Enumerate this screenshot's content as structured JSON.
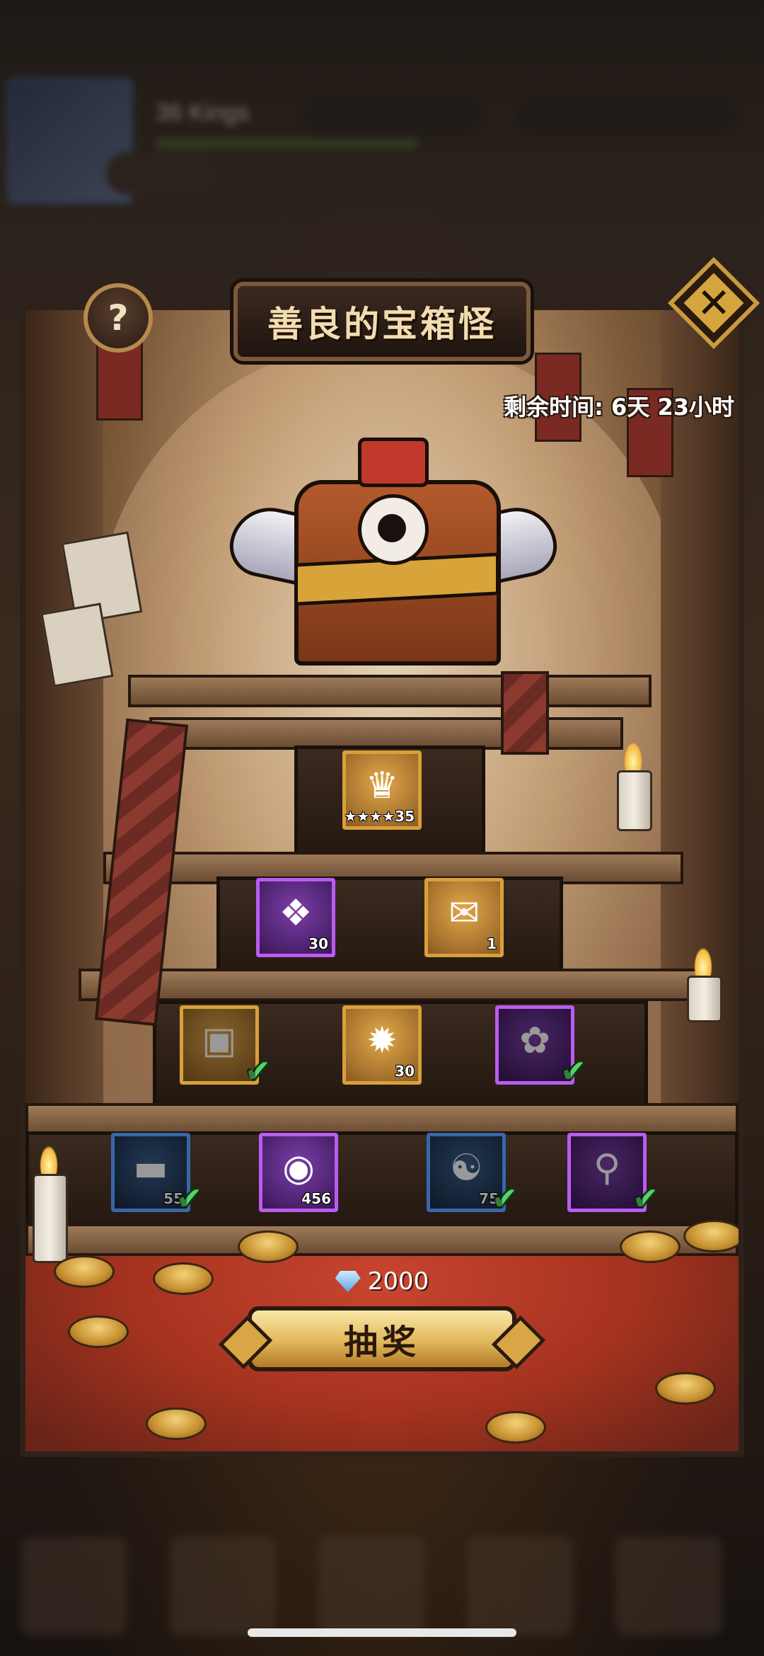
{
  "title": "善良的宝箱怪",
  "timer": {
    "label": "剩余时间:",
    "value": "6天 23小时"
  },
  "help_icon_glyph": "?",
  "close_icon_glyph": "✕",
  "rewards": [
    {
      "id": "r1",
      "icon": "hero-shard-icon",
      "glyph": "♛",
      "qty": "★★★★35",
      "rarity": "gold",
      "owned": false
    },
    {
      "id": "r2",
      "icon": "purple-scroll-icon",
      "glyph": "❖",
      "qty": "30",
      "rarity": "purple",
      "owned": false
    },
    {
      "id": "r3",
      "icon": "contract-scroll-icon",
      "glyph": "✉",
      "qty": "1",
      "rarity": "gold",
      "owned": false
    },
    {
      "id": "r4",
      "icon": "treasure-chest-icon",
      "glyph": "▣",
      "qty": "",
      "rarity": "gold",
      "owned": true
    },
    {
      "id": "r5",
      "icon": "compass-rune-icon",
      "glyph": "✹",
      "qty": "30",
      "rarity": "gold",
      "owned": false
    },
    {
      "id": "r6",
      "icon": "flower-scroll-icon",
      "glyph": "✿",
      "qty": "",
      "rarity": "purple",
      "owned": true
    },
    {
      "id": "r7",
      "icon": "iron-ingot-icon",
      "glyph": "▬",
      "qty": "55",
      "rarity": "blue",
      "owned": true
    },
    {
      "id": "r8",
      "icon": "gold-orb-icon",
      "glyph": "◉",
      "qty": "456",
      "rarity": "purple",
      "owned": false
    },
    {
      "id": "r9",
      "icon": "wind-orb-icon",
      "glyph": "☯",
      "qty": "75",
      "rarity": "blue",
      "owned": true
    },
    {
      "id": "r10",
      "icon": "scroll-bundle-icon",
      "glyph": "⚲",
      "qty": "",
      "rarity": "purple",
      "owned": true
    }
  ],
  "check_glyph": "✔",
  "cost": {
    "icon": "diamond-icon",
    "amount": "2000"
  },
  "draw_button": "抽奖"
}
